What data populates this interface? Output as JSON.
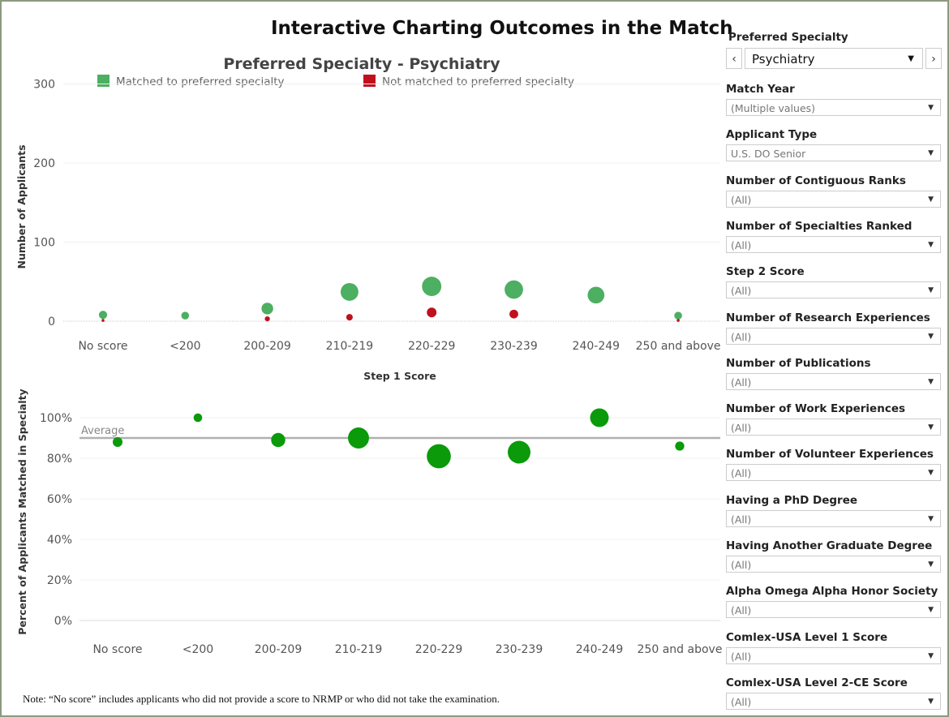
{
  "title": "Interactive Charting Outcomes in the Match",
  "note": "Note: “No score” includes applicants who did not provide a score to NRMP or who did not take the examination.",
  "colors": {
    "matched": "#4caf62",
    "not_matched": "#c0101e",
    "percent": "#0a9a0a",
    "average_line": "#b0b0b0"
  },
  "chart_data": [
    {
      "type": "scatter",
      "title": "Preferred Specialty - Psychiatry",
      "xlabel": "Step 1 Score",
      "ylabel": "Number of Applicants",
      "categories": [
        "No score",
        "<200",
        "200-209",
        "210-219",
        "220-229",
        "230-239",
        "240-249",
        "250 and above"
      ],
      "ylim": [
        0,
        300
      ],
      "yticks": [
        "0",
        "100",
        "200",
        "300"
      ],
      "legend": "top",
      "grid": true,
      "series": [
        {
          "name": "Matched to preferred specialty",
          "values": [
            8,
            7,
            16,
            37,
            44,
            40,
            33,
            7
          ]
        },
        {
          "name": "Not matched to preferred specialty",
          "values": [
            1,
            null,
            3,
            5,
            11,
            9,
            null,
            1
          ]
        }
      ]
    },
    {
      "type": "scatter",
      "ylabel": "Percent of Applicants Matched in Specialty",
      "categories": [
        "No score",
        "<200",
        "200-209",
        "210-219",
        "220-229",
        "230-239",
        "240-249",
        "250 and above"
      ],
      "ylim": [
        -10,
        110
      ],
      "yticks": [
        "0%",
        "20%",
        "40%",
        "60%",
        "80%",
        "100%"
      ],
      "grid": true,
      "values": [
        88,
        100,
        89,
        90,
        81,
        83,
        100,
        86
      ],
      "bubble_size_applicants": [
        9,
        7,
        19,
        42,
        55,
        49,
        33,
        8
      ],
      "reference_line": {
        "label": "Average",
        "value": 90
      }
    }
  ],
  "sidebar": {
    "preferred_specialty": {
      "label": "Preferred Specialty",
      "value": "Psychiatry",
      "prev": "‹",
      "next": "›"
    },
    "filters": [
      {
        "label": "Match Year",
        "value": "(Multiple values)"
      },
      {
        "label": "Applicant Type",
        "value": "U.S. DO Senior"
      },
      {
        "label": "Number of Contiguous Ranks",
        "value": "(All)"
      },
      {
        "label": "Number of Specialties Ranked",
        "value": "(All)"
      },
      {
        "label": "Step 2 Score",
        "value": "(All)"
      },
      {
        "label": "Number of Research Experiences",
        "value": "(All)"
      },
      {
        "label": "Number of Publications",
        "value": "(All)"
      },
      {
        "label": "Number of Work Experiences",
        "value": "(All)"
      },
      {
        "label": "Number of Volunteer Experiences",
        "value": "(All)"
      },
      {
        "label": "Having a PhD Degree",
        "value": "(All)"
      },
      {
        "label": "Having Another Graduate Degree",
        "value": "(All)"
      },
      {
        "label": "Alpha Omega Alpha Honor Society",
        "value": "(All)"
      },
      {
        "label": "Comlex-USA Level 1 Score",
        "value": "(All)"
      },
      {
        "label": "Comlex-USA Level 2-CE Score",
        "value": "(All)"
      }
    ]
  }
}
